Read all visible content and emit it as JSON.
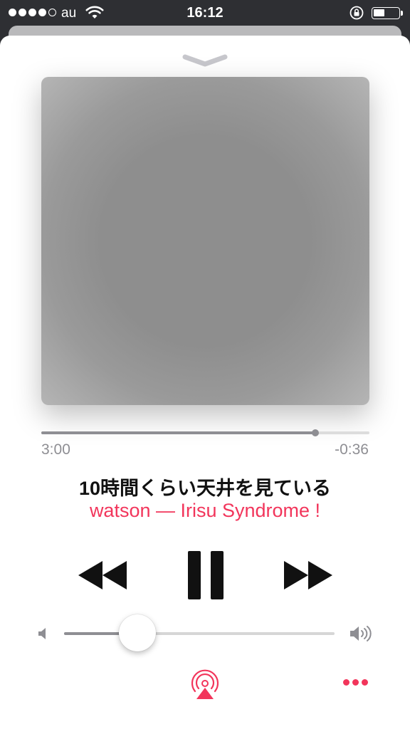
{
  "status_bar": {
    "carrier": "au",
    "time": "16:12",
    "signal_bars": 4,
    "signal_max": 5,
    "battery_level": 0.45
  },
  "player": {
    "progress": 0.835,
    "elapsed": "3:00",
    "remaining": "-0:36",
    "title": "10時間くらい天井を見ている",
    "artist_album": "watson — Irisu Syndrome !",
    "volume": 0.27
  },
  "controls": {
    "rewind_icon": "rewind-icon",
    "pause_icon": "pause-icon",
    "forward_icon": "fast-forward-icon",
    "airplay_icon": "airplay-icon",
    "more_icon": "more-icon"
  },
  "colors": {
    "accent": "#f2355b",
    "progress": "#8e8e93",
    "status_bar_bg": "#2e2f33"
  }
}
